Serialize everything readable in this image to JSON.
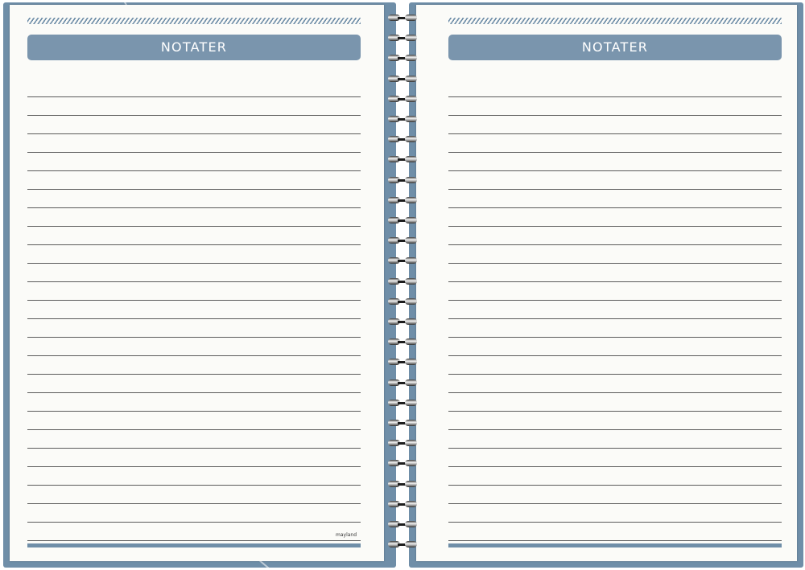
{
  "spread": {
    "left_page": {
      "header": "NOTATER",
      "brand_mark": "mayland"
    },
    "right_page": {
      "header": "NOTATER"
    }
  },
  "colors": {
    "accent": "#7a95ad",
    "cover": "#6f8ea8",
    "paper": "#fbfbf8",
    "rule_line": "#5a5a5a"
  },
  "icons": {
    "binding": "spiral-binding-icon"
  }
}
